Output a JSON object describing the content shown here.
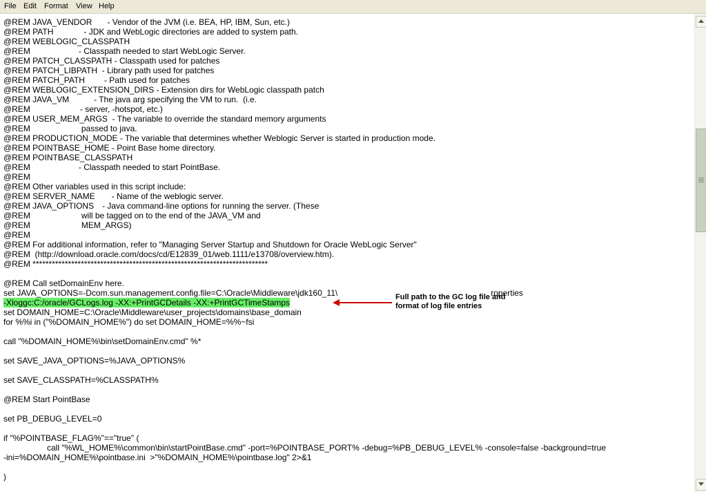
{
  "menu": {
    "file": "File",
    "edit": "Edit",
    "format": "Format",
    "view": "View",
    "help": "Help"
  },
  "editor": {
    "lines": {
      "l0": [
        "@REM JAVA_VENDOR",
        "- Vendor of the JVM (i.e. BEA, HP, IBM, Sun, etc.)"
      ],
      "l1": [
        "@REM PATH",
        "- JDK and WebLogic directories are added to system path."
      ],
      "l2": "@REM WEBLOGIC_CLASSPATH",
      "l3": [
        "@REM",
        "- Classpath needed to start WebLogic Server."
      ],
      "l4": "@REM PATCH_CLASSPATH - Classpath used for patches",
      "l5": "@REM PATCH_LIBPATH  - Library path used for patches",
      "l6": [
        "@REM PATCH_PATH",
        "- Path used for patches"
      ],
      "l7": "@REM WEBLOGIC_EXTENSION_DIRS - Extension dirs for WebLogic classpath patch",
      "l8": [
        "@REM JAVA_VM",
        "- The java arg specifying the VM to run.  (i.e."
      ],
      "l9": [
        "@REM",
        "- server, -hotspot, etc.)"
      ],
      "l10": "@REM USER_MEM_ARGS  - The variable to override the standard memory arguments",
      "l11": [
        "@REM",
        "passed to java."
      ],
      "l12": "@REM PRODUCTION_MODE - The variable that determines whether Weblogic Server is started in production mode.",
      "l13": "@REM POINTBASE_HOME - Point Base home directory.",
      "l14": "@REM POINTBASE_CLASSPATH",
      "l15": [
        "@REM",
        "- Classpath needed to start PointBase."
      ],
      "l16": "@REM",
      "l17": "@REM Other variables used in this script include:",
      "l18": [
        "@REM SERVER_NAME",
        "- Name of the weblogic server."
      ],
      "l19": [
        "@REM JAVA_OPTIONS",
        "- Java command-line options for running the server. (These"
      ],
      "l20": [
        "@REM",
        "will be tagged on to the end of the JAVA_VM and"
      ],
      "l21": [
        "@REM",
        "MEM_ARGS)"
      ],
      "l22": "@REM",
      "l23": "@REM For additional information, refer to \"Managing Server Startup and Shutdown for Oracle WebLogic Server\"",
      "l24": "@REM  (http://download.oracle.com/docs/cd/E12839_01/web.1111/e13708/overview.htm).",
      "l25": "@REM *************************************************************************",
      "l27": "@REM Call setDomainEnv here.",
      "l28a": "set JAVA_OPTIONS=-Dcom.sun.management.config.file=C:\\Oracle\\Middleware\\jdk160_11\\",
      "l28b": "roperties",
      "l29": "-Xloggc:C:/oracle/GCLogs.log -XX:+PrintGCDetails -XX:+PrintGCTimeStamps",
      "l30": "set DOMAIN_HOME=C:\\Oracle\\Middleware\\user_projects\\domains\\base_domain",
      "l31": "for %%i in (\"%DOMAIN_HOME%\") do set DOMAIN_HOME=%%~fsi",
      "l33": "call \"%DOMAIN_HOME%\\bin\\setDomainEnv.cmd\" %*",
      "l35": "set SAVE_JAVA_OPTIONS=%JAVA_OPTIONS%",
      "l37": "set SAVE_CLASSPATH=%CLASSPATH%",
      "l39": "@REM Start PointBase",
      "l41": "set PB_DEBUG_LEVEL=0",
      "l43": "if \"%POINTBASE_FLAG%\"==\"true\" (",
      "l44": "call \"%WL_HOME%\\common\\bin\\startPointBase.cmd\" -port=%POINTBASE_PORT% -debug=%PB_DEBUG_LEVEL% -console=false -background=true",
      "l45": "-ini=%DOMAIN_HOME%\\pointbase.ini  >\"%DOMAIN_HOME%\\pointbase.log\" 2>&1",
      "l47": ")"
    }
  },
  "annotation": {
    "line1": "Full path to the GC log file and",
    "line2": "format of log file entries",
    "arrow_color": "#cc0000"
  },
  "highlight_color": "#66ee66",
  "scrollbar": {
    "up_icon": "arrow-up-icon",
    "down_icon": "arrow-down-icon"
  }
}
